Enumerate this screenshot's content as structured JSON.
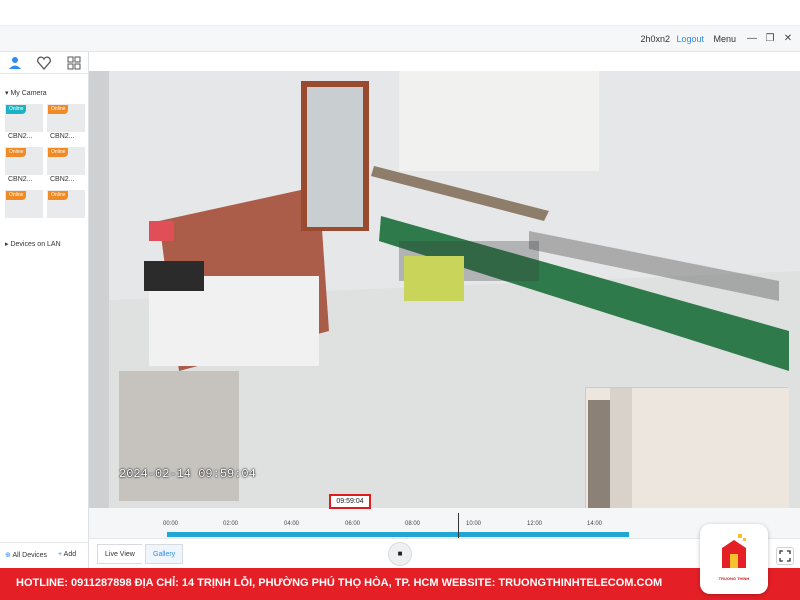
{
  "app": {
    "user": "2h0xn2",
    "logout": "Logout",
    "menu": "Menu",
    "minimize_icon": "minimize-icon",
    "restore_icon": "restore-icon",
    "close_icon": "close-icon"
  },
  "sidebar": {
    "tabs": [
      "person-icon",
      "heart-icon",
      "grid-icon"
    ],
    "my_camera": "My Camera",
    "cameras": [
      {
        "label": "CBN2...",
        "status": "Online",
        "color": "#19b3c4"
      },
      {
        "label": "CBN2...",
        "status": "Online",
        "color": "#f08a24"
      },
      {
        "label": "CBN2...",
        "status": "Online",
        "color": "#f08a24"
      },
      {
        "label": "CBN2...",
        "status": "Online",
        "color": "#f08a24"
      },
      {
        "label": "",
        "status": "Online",
        "color": "#f08a24"
      },
      {
        "label": "",
        "status": "Online",
        "color": "#f08a24"
      }
    ],
    "devices_on_lan": "Devices on LAN",
    "all_devices": "All Devices",
    "add": "Add"
  },
  "video": {
    "timestamp": "2024-02-14  09:59:04"
  },
  "timeline": {
    "current_time": "09:59:04",
    "ticks": [
      "00:00",
      "02:00",
      "04:00",
      "06:00",
      "08:00",
      "10:00",
      "12:00",
      "14:00"
    ]
  },
  "controls": {
    "live_view": "Live View",
    "gallery": "Gallery",
    "stop_icon": "stop-icon",
    "fullscreen_icon": "fullscreen-icon"
  },
  "footer": {
    "text": "HOTLINE: 0911287898     ĐỊA CHỈ: 14 TRỊNH LỖI, PHƯỜNG PHÚ THỌ HÒA, TP. HCM     WEBSITE: TRUONGTHINHTELECOM.COM",
    "logo_text": "TRUONG THINH"
  },
  "colors": {
    "accent": "#2d8cf0",
    "record_bar": "#1fa5d6",
    "footer": "#e41f26",
    "marker": "#e01d1d"
  }
}
